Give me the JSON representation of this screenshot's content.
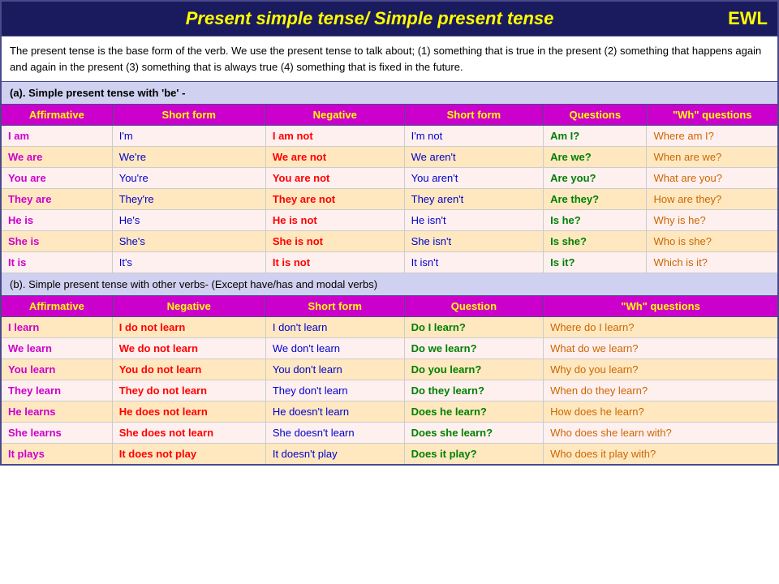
{
  "title": {
    "main": "Present simple tense/ Simple present tense",
    "brand": "EWL"
  },
  "intro": {
    "text": "The present tense is the base form of the verb. We use the present tense to talk about; (1) something that is true in the present (2) something that happens again and again in the present (3) something that is always true (4) something that is fixed in the future."
  },
  "section_a": {
    "header": "(a). Simple present tense with 'be' -",
    "columns": [
      "Affirmative",
      "Short form",
      "Negative",
      "Short form",
      "Questions",
      "\"Wh\" questions"
    ],
    "rows": [
      [
        "I am",
        "I'm",
        "I am not",
        "I'm not",
        "Am I?",
        "Where am I?"
      ],
      [
        "We are",
        "We're",
        "We are not",
        "We aren't",
        "Are we?",
        "When are we?"
      ],
      [
        "You are",
        "You're",
        "You are not",
        "You aren't",
        "Are you?",
        "What are you?"
      ],
      [
        "They are",
        "They're",
        "They are not",
        "They aren't",
        "Are they?",
        "How are they?"
      ],
      [
        "He is",
        "He's",
        "He is not",
        "He isn't",
        "Is he?",
        "Why is he?"
      ],
      [
        "She is",
        "She's",
        "She is not",
        "She isn't",
        "Is she?",
        "Who is she?"
      ],
      [
        "It is",
        "It's",
        "It is not",
        "It isn't",
        "Is it?",
        "Which is it?"
      ]
    ]
  },
  "section_b": {
    "header": "(b). Simple present tense with other verbs-  (Except have/has and modal verbs)",
    "columns": [
      "Affirmative",
      "Negative",
      "Short form",
      "Question",
      "\"Wh\" questions"
    ],
    "rows": [
      [
        "I learn",
        "I do not learn",
        "I don't learn",
        "Do I learn?",
        "Where do I learn?"
      ],
      [
        "We learn",
        "We do not learn",
        "We don't learn",
        "Do we learn?",
        "What do we learn?"
      ],
      [
        "You learn",
        "You do not learn",
        "You don't learn",
        "Do you learn?",
        "Why do you learn?"
      ],
      [
        "They learn",
        "They do not learn",
        "They don't learn",
        "Do they learn?",
        "When do they learn?"
      ],
      [
        "He learns",
        "He does not learn",
        "He doesn't learn",
        "Does he learn?",
        "How does he learn?"
      ],
      [
        "She learns",
        "She does not learn",
        "She doesn't learn",
        "Does she learn?",
        "Who does she learn with?"
      ],
      [
        "It plays",
        "It does not play",
        "It doesn't play",
        "Does it play?",
        "Who does it play with?"
      ]
    ]
  }
}
